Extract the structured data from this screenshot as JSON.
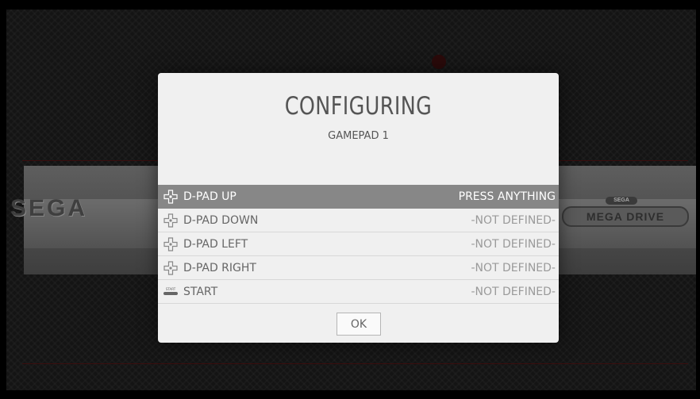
{
  "dialog": {
    "title": "CONFIGURING",
    "subtitle": "GAMEPAD 1",
    "rows": [
      {
        "label": "D-PAD UP",
        "value": "PRESS ANYTHING",
        "icon": "dpad-icon",
        "active": true
      },
      {
        "label": "D-PAD DOWN",
        "value": "-NOT DEFINED-",
        "icon": "dpad-icon",
        "active": false
      },
      {
        "label": "D-PAD LEFT",
        "value": "-NOT DEFINED-",
        "icon": "dpad-icon",
        "active": false
      },
      {
        "label": "D-PAD RIGHT",
        "value": "-NOT DEFINED-",
        "icon": "dpad-icon",
        "active": false
      },
      {
        "label": "START",
        "value": "-NOT DEFINED-",
        "icon": "start-button-icon",
        "active": false
      }
    ],
    "ok_label": "OK"
  },
  "background": {
    "left_logo": "SEGA",
    "right_logo_top": "SEGA",
    "right_logo_main": "MEGA DRIVE"
  },
  "start_icon_text": "START"
}
